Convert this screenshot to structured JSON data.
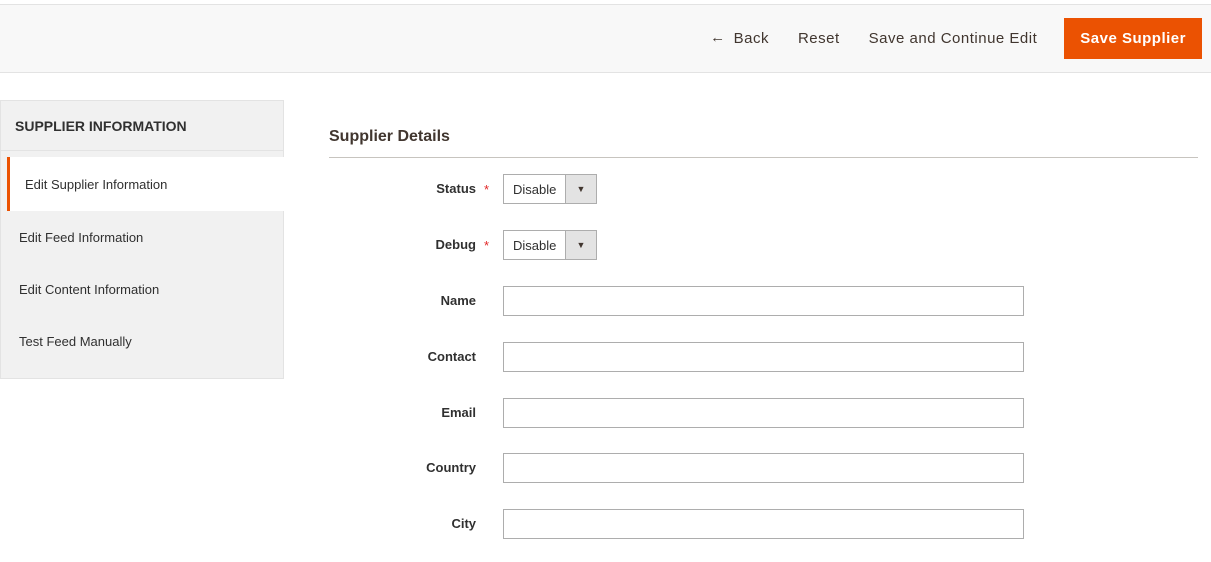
{
  "toolbar": {
    "back_label": "Back",
    "reset_label": "Reset",
    "save_continue_label": "Save and Continue Edit",
    "save_label": "Save Supplier"
  },
  "sidebar": {
    "title": "SUPPLIER INFORMATION",
    "items": [
      {
        "label": "Edit Supplier Information",
        "active": true
      },
      {
        "label": "Edit Feed Information",
        "active": false
      },
      {
        "label": "Edit Content Information",
        "active": false
      },
      {
        "label": "Test Feed Manually",
        "active": false
      }
    ]
  },
  "form": {
    "section_title": "Supplier Details",
    "status": {
      "label": "Status",
      "value": "Disable",
      "required": true
    },
    "debug": {
      "label": "Debug",
      "value": "Disable",
      "required": true
    },
    "name": {
      "label": "Name",
      "value": ""
    },
    "contact": {
      "label": "Contact",
      "value": ""
    },
    "email": {
      "label": "Email",
      "value": ""
    },
    "country": {
      "label": "Country",
      "value": ""
    },
    "city": {
      "label": "City",
      "value": ""
    }
  },
  "icons": {
    "back": "arrow-left-icon",
    "dropdown": "caret-down-icon"
  },
  "colors": {
    "accent": "#eb5202",
    "required": "#e22626"
  }
}
